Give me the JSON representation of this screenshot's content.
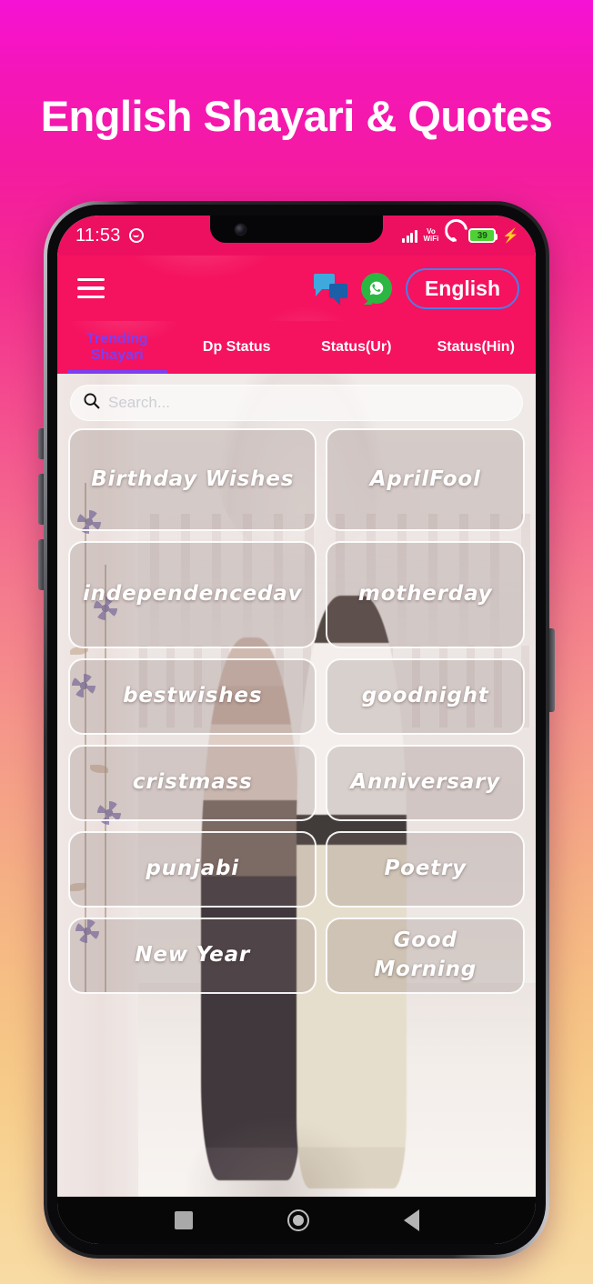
{
  "promo": {
    "title": "English Shayari & Quotes"
  },
  "statusbar": {
    "time": "11:53",
    "emoji_icon": "smiley-face-icon",
    "signal_icon": "cellular-signal-icon",
    "vowifi_line1": "Vo",
    "vowifi_line2": "WiFi",
    "wifi_icon": "wifi-icon",
    "battery_level": "39",
    "charging_icon": "lightning-bolt-icon"
  },
  "appbar": {
    "menu_icon": "hamburger-menu-icon",
    "chat_icon": "chat-bubbles-icon",
    "whatsapp_icon": "whatsapp-icon",
    "language_label": "English"
  },
  "tabs": [
    {
      "label": "Trending Shayari",
      "active": true
    },
    {
      "label": "Dp Status",
      "active": false
    },
    {
      "label": "Status(Ur)",
      "active": false
    },
    {
      "label": "Status(Hin)",
      "active": false
    }
  ],
  "search": {
    "icon": "search-icon",
    "value": "",
    "placeholder": "Search..."
  },
  "categories": [
    {
      "label": "Birthday Wishes"
    },
    {
      "label": "AprilFool"
    },
    {
      "label": "independencedav"
    },
    {
      "label": "motherday"
    },
    {
      "label": "bestwishes"
    },
    {
      "label": "goodnight"
    },
    {
      "label": "cristmass"
    },
    {
      "label": "Anniversary"
    },
    {
      "label": "punjabi"
    },
    {
      "label": "Poetry"
    },
    {
      "label": "New Year"
    },
    {
      "label": "Good Morning"
    }
  ],
  "navbar": {
    "recents_icon": "square-recents-icon",
    "home_icon": "circle-home-icon",
    "back_icon": "triangle-back-icon"
  },
  "colors": {
    "brand_pink": "#F5125E",
    "statusbar_pink": "#EE1060",
    "active_tab_purple": "#7B3FF2",
    "lang_border_blue": "#4D7CE8",
    "whatsapp_green": "#2BB741",
    "chat_blue_light": "#3FA9DE",
    "chat_blue_dark": "#1B5FA8",
    "battery_green": "#4ED136",
    "bg_gradient_top": "#F612D4",
    "bg_gradient_bottom": "#F8DBA4"
  }
}
